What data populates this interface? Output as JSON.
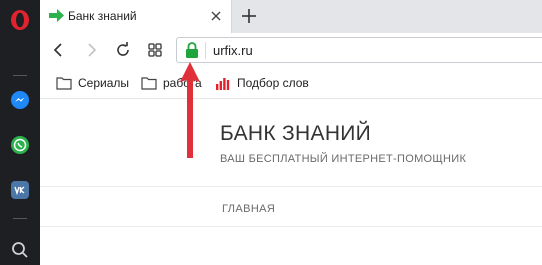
{
  "tab": {
    "title": "Банк знаний"
  },
  "address_bar": {
    "url": "urfix.ru"
  },
  "bookmarks": [
    {
      "label": "Сериалы"
    },
    {
      "label": "работа"
    },
    {
      "label": "Подбор слов"
    }
  ],
  "page": {
    "site_title": "БАНК ЗНАНИЙ",
    "site_subtitle": "ВАШ БЕСПЛАТНЫЙ ИНТЕРНЕТ-ПОМОЩНИК",
    "nav_home": "ГЛАВНАЯ"
  },
  "colors": {
    "opera_red": "#e0232e",
    "lock_green": "#1fa33b",
    "annotation_red": "#e0303a",
    "favicon_green": "#2bb24c"
  },
  "icons": [
    "opera-logo-icon",
    "messenger-icon",
    "whatsapp-icon",
    "vk-icon",
    "search-icon",
    "back-icon",
    "forward-icon",
    "reload-icon",
    "speed-dial-icon",
    "lock-icon",
    "folder-icon",
    "bar-chart-icon"
  ]
}
